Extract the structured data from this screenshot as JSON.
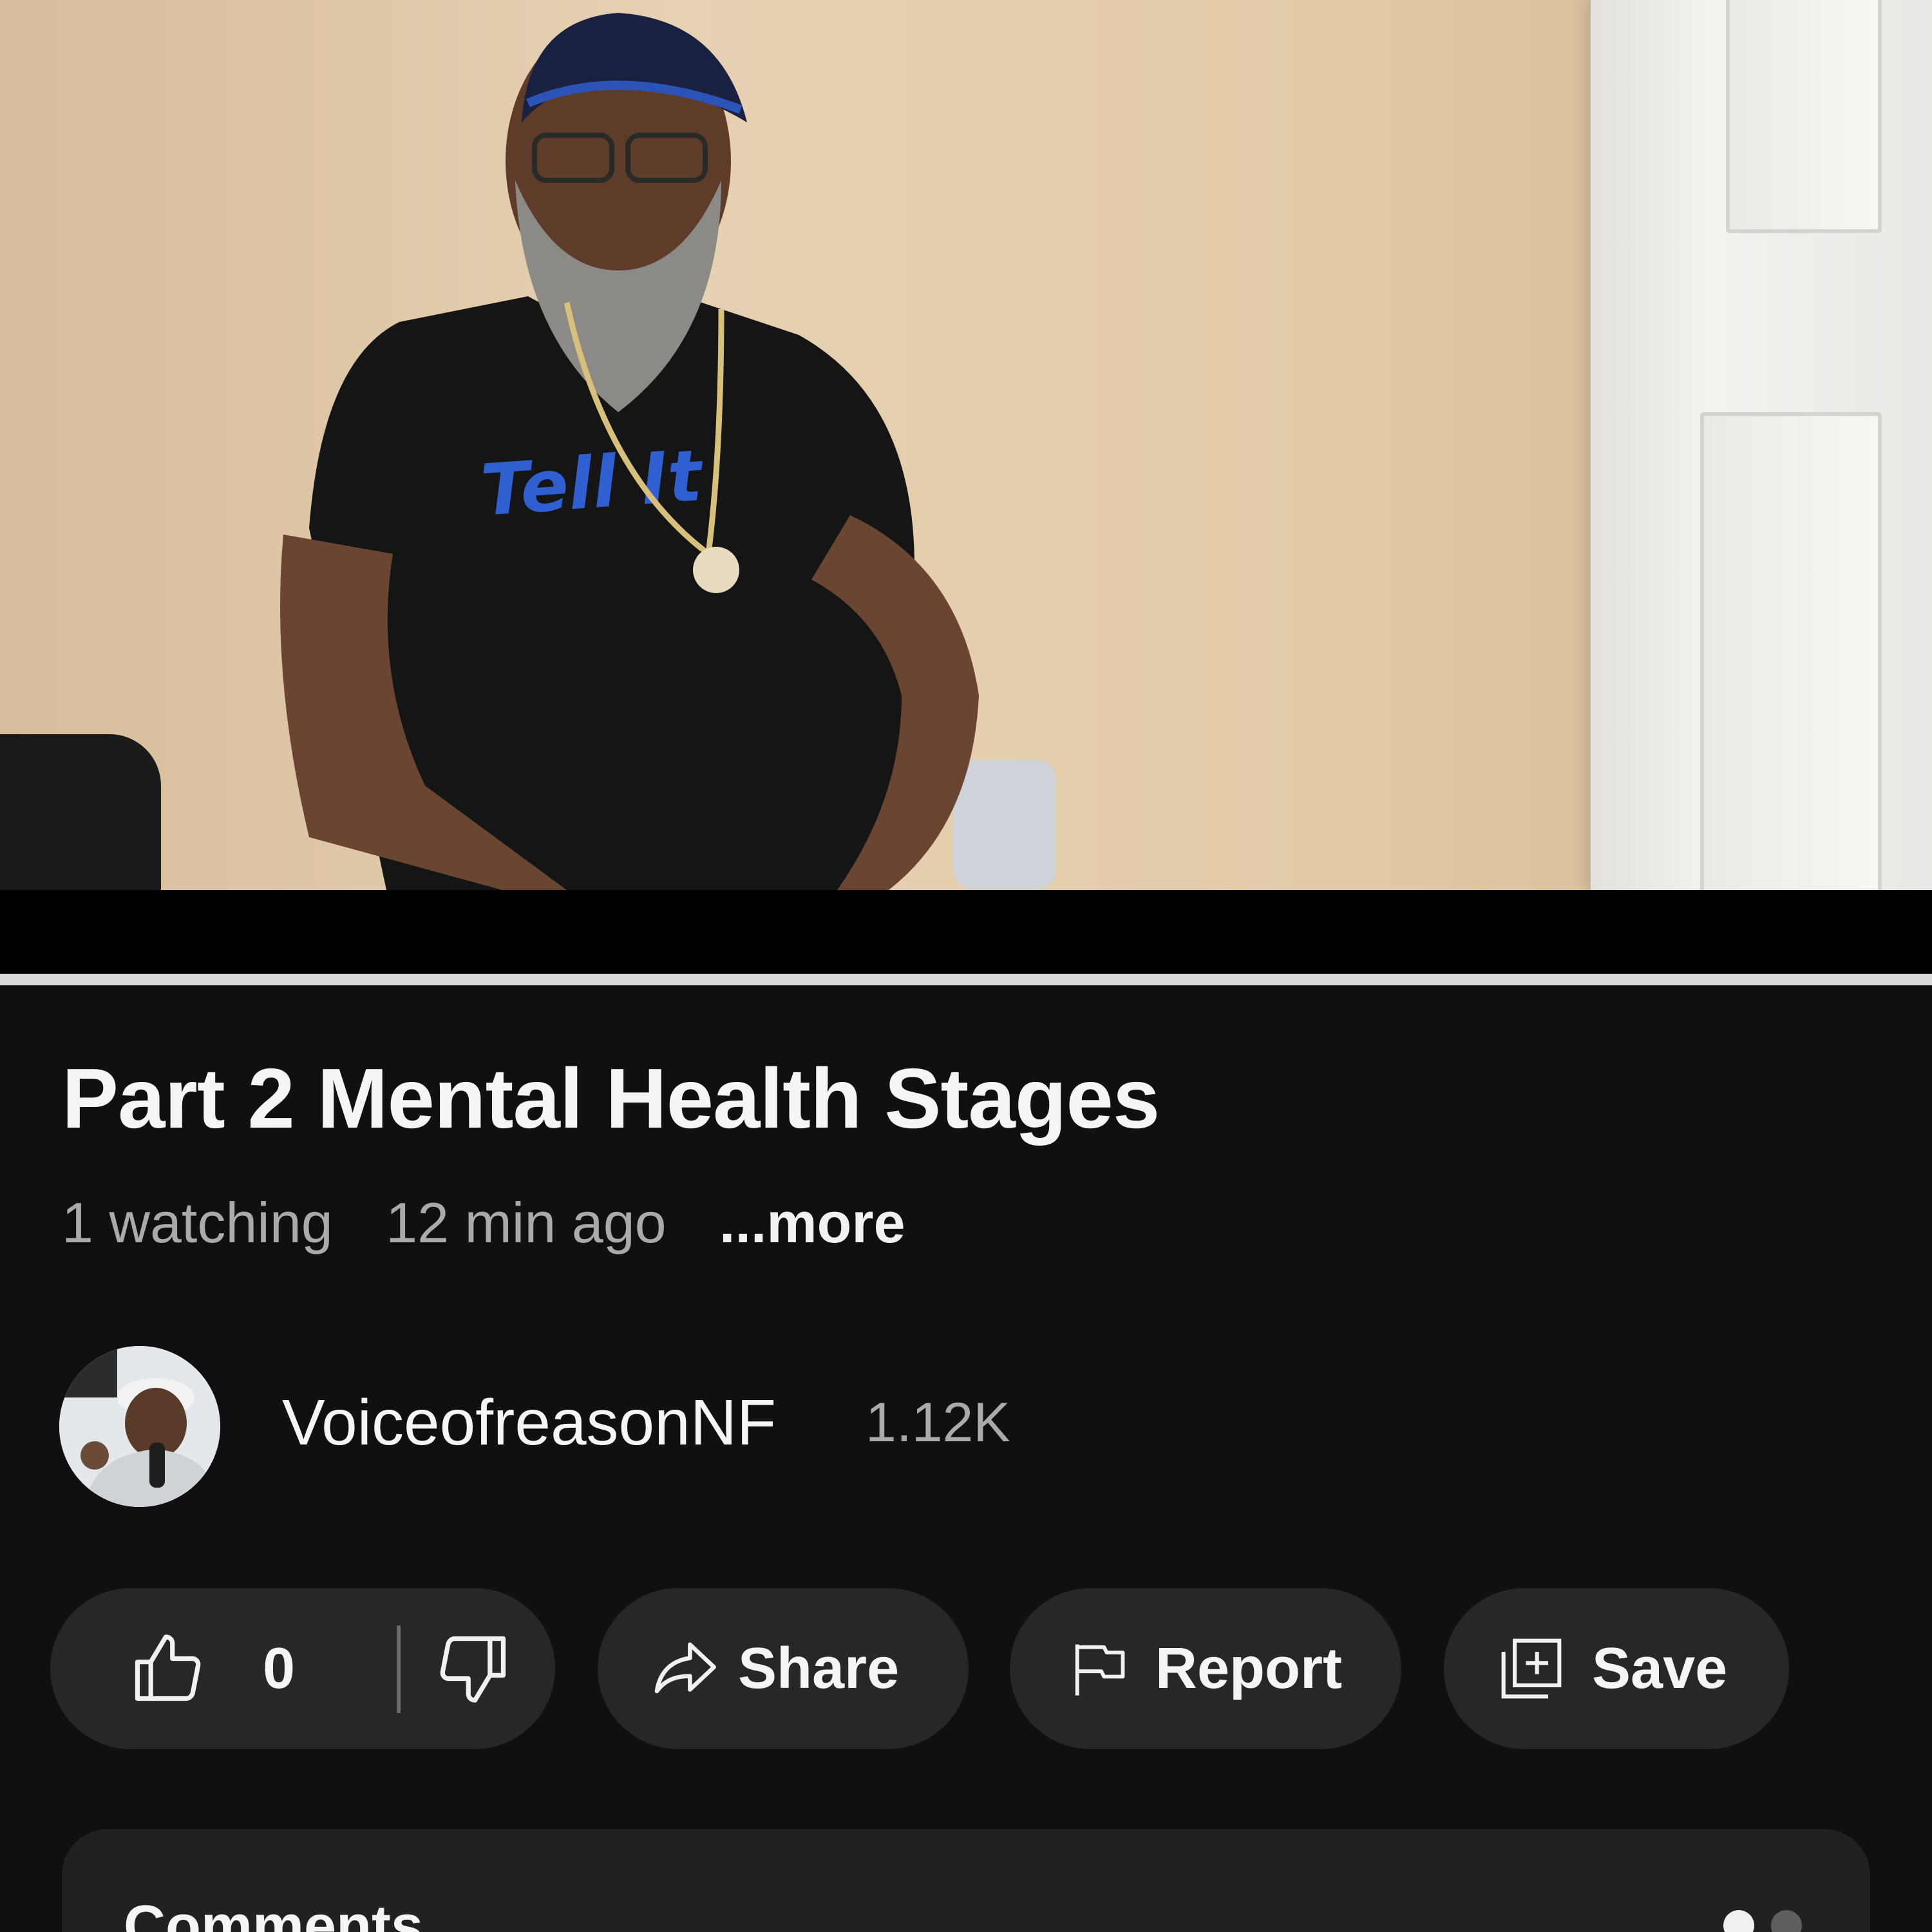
{
  "video": {
    "progress_fraction": 1.0
  },
  "title": "Part 2 Mental Health Stages",
  "meta": {
    "watching": "1 watching",
    "time": "12 min ago",
    "more": "...more"
  },
  "channel": {
    "name": "VoiceofreasonNF",
    "subscribers": "1.12K"
  },
  "actions": {
    "like_count": "0",
    "share": "Share",
    "report": "Report",
    "save": "Save"
  },
  "comments": {
    "title": "Comments"
  },
  "icons": {
    "like": "thumb-up-icon",
    "dislike": "thumb-down-icon",
    "share": "share-arrow-icon",
    "report": "flag-icon",
    "save": "save-playlist-icon"
  },
  "colors": {
    "background": "#0f1111",
    "chip": "#272727",
    "text_primary": "#f1f1f1",
    "text_secondary": "#aaaaaa",
    "progress": "#d9d9d9"
  }
}
